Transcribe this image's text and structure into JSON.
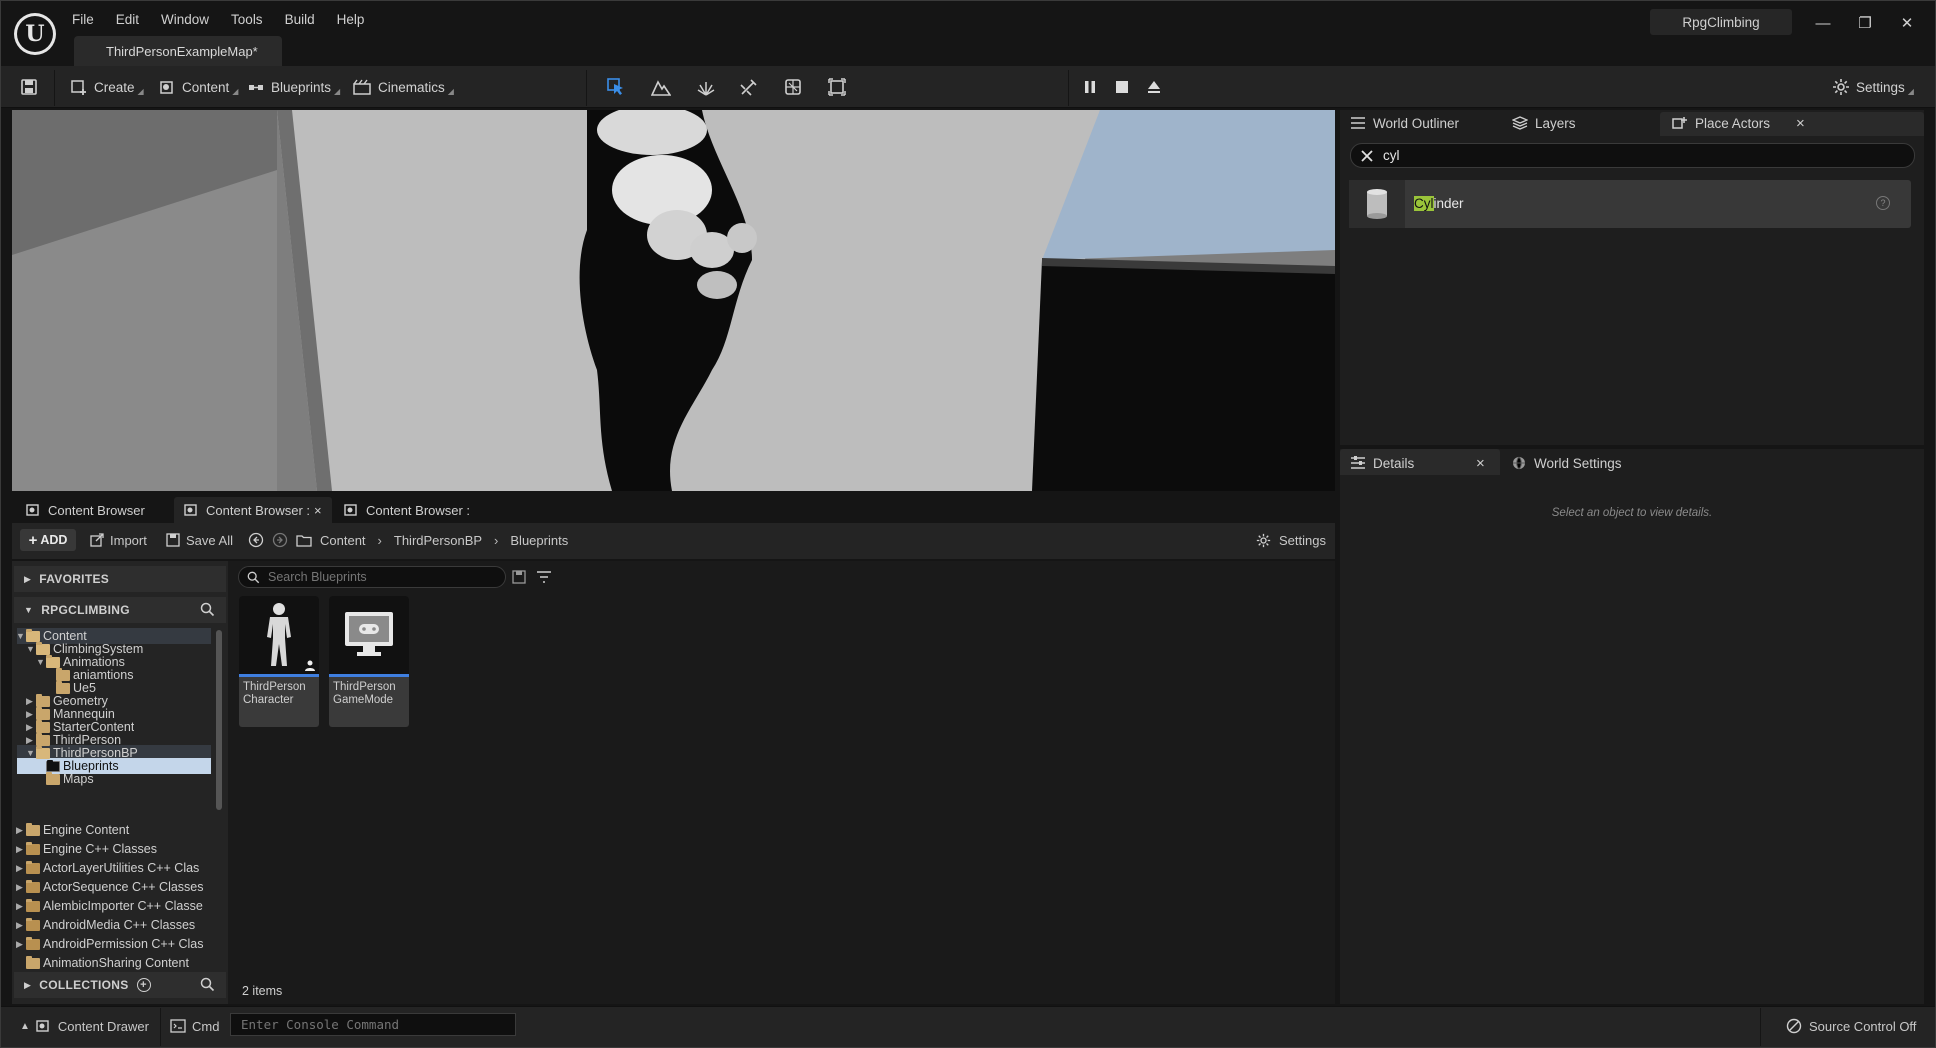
{
  "window": {
    "menu": [
      "File",
      "Edit",
      "Window",
      "Tools",
      "Build",
      "Help"
    ],
    "map_tab": "ThirdPersonExampleMap*",
    "project_name": "RpgClimbing",
    "minimize": "—",
    "restore": "❐",
    "close": "✕"
  },
  "toolbar": {
    "create": "Create",
    "content": "Content",
    "blueprints": "Blueprints",
    "cinematics": "Cinematics",
    "settings": "Settings"
  },
  "right_tabs": {
    "world_outliner": "World Outliner",
    "layers": "Layers",
    "place_actors": "Place Actors",
    "close": "×"
  },
  "place_actors": {
    "search_value": "cyl",
    "result_match": "Cyl",
    "result_rest": "inder"
  },
  "details": {
    "tab_details": "Details",
    "tab_world_settings": "World Settings",
    "close": "×",
    "empty_hint": "Select an object to view details."
  },
  "content_browser": {
    "tabs": [
      "Content Browser",
      "Content Browser :",
      "Content Browser :"
    ],
    "add": "ADD",
    "import": "Import",
    "save_all": "Save All",
    "breadcrumb": [
      "Content",
      "ThirdPersonBP",
      "Blueprints"
    ],
    "settings": "Settings",
    "favorites": "FAVORITES",
    "project": "RPGCLIMBING",
    "collections": "COLLECTIONS",
    "search_placeholder": "Search Blueprints",
    "item_count": "2 items",
    "tree": [
      {
        "label": "Content",
        "depth": 0,
        "arrow": "▼",
        "open": true
      },
      {
        "label": "ClimbingSystem",
        "depth": 1,
        "arrow": "▼",
        "open": true
      },
      {
        "label": "Animations",
        "depth": 2,
        "arrow": "▼",
        "open": true
      },
      {
        "label": "aniamtions",
        "depth": 3,
        "arrow": "",
        "open": false
      },
      {
        "label": "Ue5",
        "depth": 3,
        "arrow": "",
        "open": false
      },
      {
        "label": "Geometry",
        "depth": 1,
        "arrow": "▶",
        "open": false
      },
      {
        "label": "Mannequin",
        "depth": 1,
        "arrow": "▶",
        "open": false
      },
      {
        "label": "StarterContent",
        "depth": 1,
        "arrow": "▶",
        "open": false
      },
      {
        "label": "ThirdPerson",
        "depth": 1,
        "arrow": "▶",
        "open": false
      },
      {
        "label": "ThirdPersonBP",
        "depth": 1,
        "arrow": "▼",
        "open": true
      },
      {
        "label": "Blueprints",
        "depth": 2,
        "arrow": "",
        "open": false
      },
      {
        "label": "Maps",
        "depth": 2,
        "arrow": "",
        "open": false
      }
    ],
    "tree_more": [
      {
        "label": "Engine Content",
        "cls": false
      },
      {
        "label": "Engine C++ Classes",
        "cls": true
      },
      {
        "label": "ActorLayerUtilities C++ Clas",
        "cls": true
      },
      {
        "label": "ActorSequence C++ Classes",
        "cls": true
      },
      {
        "label": "AlembicImporter C++ Classe",
        "cls": true
      },
      {
        "label": "AndroidMedia C++ Classes",
        "cls": true
      },
      {
        "label": "AndroidPermission C++ Clas",
        "cls": true
      },
      {
        "label": "AnimationSharing Content",
        "cls": false
      }
    ],
    "assets": [
      {
        "line1": "ThirdPerson",
        "line2": "Character"
      },
      {
        "line1": "ThirdPerson",
        "line2": "GameMode"
      }
    ]
  },
  "statusbar": {
    "content_drawer": "Content Drawer",
    "cmd": "Cmd",
    "console_placeholder": "Enter Console Command",
    "source_control": "Source Control Off"
  }
}
